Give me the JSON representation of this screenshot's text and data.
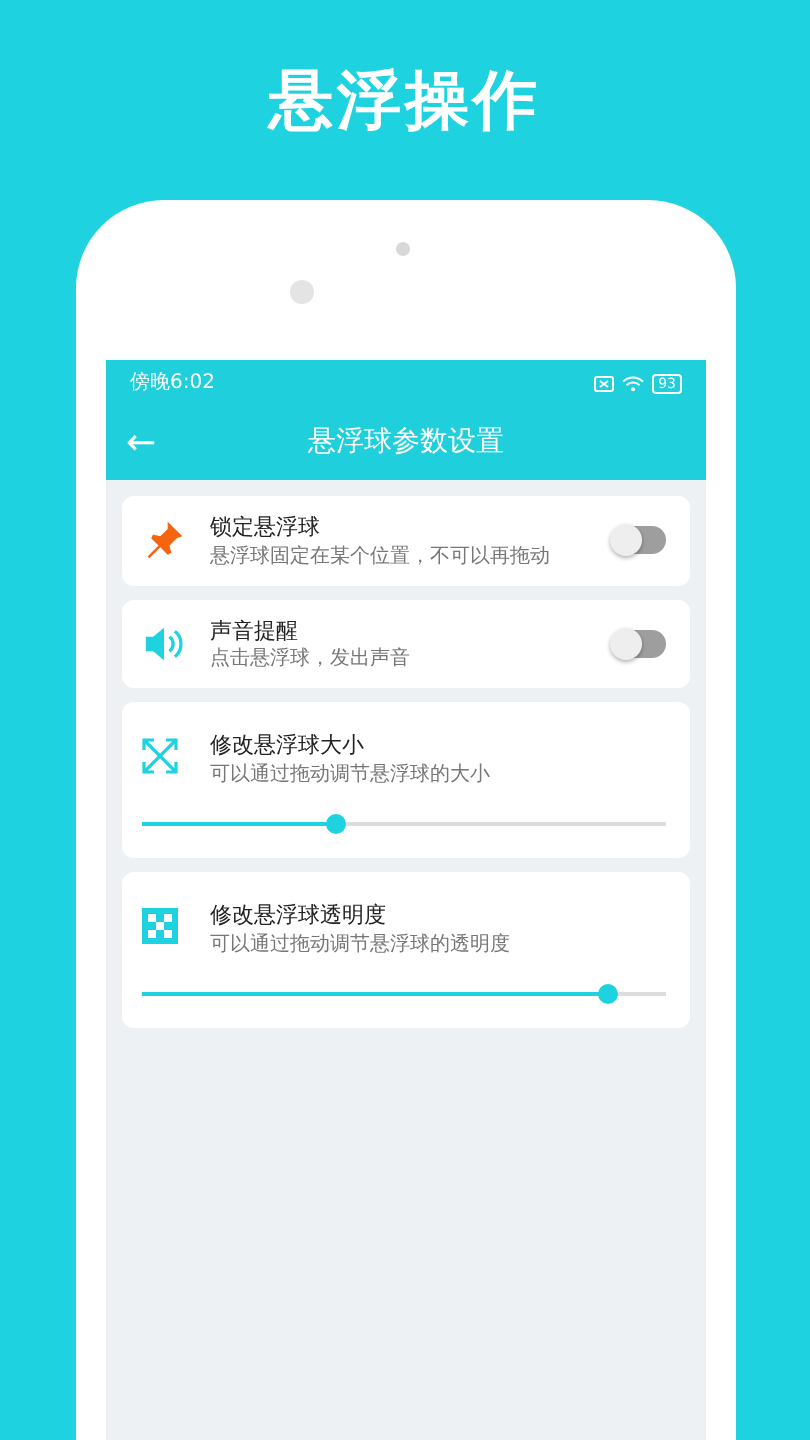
{
  "headline": "悬浮操作",
  "status_bar": {
    "time": "傍晚6:02",
    "battery": "93"
  },
  "toolbar": {
    "back": "←",
    "title": "悬浮球参数设置"
  },
  "settings": [
    {
      "kind": "switch",
      "title": "锁定悬浮球",
      "subtitle": "悬浮球固定在某个位置，不可以再拖动",
      "on": false
    },
    {
      "kind": "switch",
      "title": "声音提醒",
      "subtitle": "点击悬浮球，发出声音",
      "on": false
    },
    {
      "kind": "slider",
      "title": "修改悬浮球大小",
      "subtitle": "可以通过拖动调节悬浮球的大小",
      "level": 0.37
    },
    {
      "kind": "slider",
      "title": "修改悬浮球透明度",
      "subtitle": "可以通过拖动调节悬浮球的透明度",
      "level": 0.89
    }
  ]
}
